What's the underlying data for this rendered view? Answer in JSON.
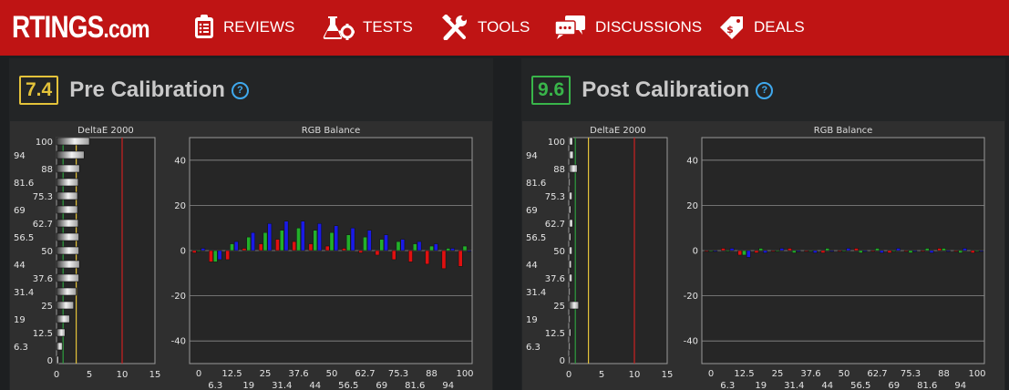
{
  "nav": {
    "logo": "RTINGS",
    "logo_suffix": ".com",
    "items": [
      {
        "label": "REVIEWS",
        "icon": "clipboard-icon"
      },
      {
        "label": "TESTS",
        "icon": "flask-icon"
      },
      {
        "label": "TOOLS",
        "icon": "tools-icon"
      },
      {
        "label": "DISCUSSIONS",
        "icon": "chat-icon"
      },
      {
        "label": "DEALS",
        "icon": "tag-icon"
      }
    ]
  },
  "panels": [
    {
      "score": "7.4",
      "title": "Pre Calibration",
      "score_color": "#e4c33a",
      "help": "?"
    },
    {
      "score": "9.6",
      "title": "Post Calibration",
      "score_color": "#39b54a",
      "help": "?"
    }
  ],
  "chart_data": [
    {
      "type": "bar",
      "title": "DeltaE 2000",
      "categories": [
        "100",
        "94",
        "88",
        "81.6",
        "75.3",
        "69",
        "62.7",
        "56.5",
        "50",
        "44",
        "37.6",
        "31.4",
        "25",
        "19",
        "12.5",
        "6.3",
        "0"
      ],
      "values": [
        5.0,
        4.2,
        3.5,
        3.3,
        3.2,
        3.2,
        3.3,
        3.4,
        3.4,
        3.5,
        3.4,
        3.0,
        2.6,
        2.0,
        1.3,
        0.9,
        0.3
      ],
      "xlim": [
        0,
        15
      ],
      "xticks": [
        "0",
        "5",
        "10",
        "15"
      ],
      "reference_lines": [
        {
          "x": 1,
          "color": "#2e9e3e"
        },
        {
          "x": 3,
          "color": "#e4c33a"
        },
        {
          "x": 10,
          "color": "#cc2020"
        }
      ]
    },
    {
      "type": "bar",
      "title": "RGB Balance",
      "categories": [
        "0",
        "6.3",
        "12.5",
        "19",
        "25",
        "31.4",
        "37.6",
        "44",
        "50",
        "56.5",
        "62.7",
        "69",
        "75.3",
        "81.6",
        "88",
        "94",
        "100"
      ],
      "xtick_rows": [
        [
          "0",
          "12.5",
          "25",
          "37.6",
          "50",
          "62.7",
          "75.3",
          "88",
          "100"
        ],
        [
          "6.3",
          "19",
          "31.4",
          "44",
          "56.5",
          "69",
          "81.6",
          "94"
        ]
      ],
      "ylim": [
        -50,
        50
      ],
      "yticks": [
        "40",
        "20",
        "0",
        "-20",
        "-40"
      ],
      "series": [
        {
          "name": "Red",
          "color": "#e01010",
          "values": [
            -1,
            -5,
            -4,
            1,
            3,
            5,
            4,
            3,
            2,
            1,
            -1,
            -2,
            -4,
            -5,
            -6,
            -8,
            -7
          ]
        },
        {
          "name": "Green",
          "color": "#22b02a",
          "values": [
            0,
            -5,
            3,
            6,
            8,
            9,
            10,
            9,
            8,
            7,
            6,
            5,
            4,
            3,
            2,
            1,
            2
          ]
        },
        {
          "name": "Blue",
          "color": "#1a1ae6",
          "values": [
            1,
            -4,
            4,
            8,
            12,
            13,
            13,
            12,
            11,
            10,
            9,
            7,
            5,
            4,
            3,
            1,
            0
          ]
        }
      ]
    },
    {
      "type": "bar",
      "title": "DeltaE 2000",
      "categories": [
        "100",
        "94",
        "88",
        "81.6",
        "75.3",
        "69",
        "62.7",
        "56.5",
        "50",
        "44",
        "37.6",
        "31.4",
        "25",
        "19",
        "12.5",
        "6.3",
        "0"
      ],
      "values": [
        0.6,
        0.7,
        1.3,
        0.2,
        0.5,
        0.3,
        0.6,
        0.3,
        0.5,
        0.4,
        0.5,
        0.2,
        1.5,
        0.2,
        0.3,
        0.2,
        0.1
      ],
      "xlim": [
        0,
        15
      ],
      "xticks": [
        "0",
        "5",
        "10",
        "15"
      ],
      "reference_lines": [
        {
          "x": 1,
          "color": "#2e9e3e"
        },
        {
          "x": 3,
          "color": "#e4c33a"
        },
        {
          "x": 10,
          "color": "#cc2020"
        }
      ]
    },
    {
      "type": "bar",
      "title": "RGB Balance",
      "categories": [
        "0",
        "6.3",
        "12.5",
        "19",
        "25",
        "31.4",
        "37.6",
        "44",
        "50",
        "56.5",
        "62.7",
        "69",
        "75.3",
        "81.6",
        "88",
        "94",
        "100"
      ],
      "xtick_rows": [
        [
          "0",
          "12.5",
          "25",
          "37.6",
          "50",
          "62.7",
          "75.3",
          "88",
          "100"
        ],
        [
          "6.3",
          "19",
          "31.4",
          "44",
          "56.5",
          "69",
          "81.6",
          "94"
        ]
      ],
      "ylim": [
        -50,
        50
      ],
      "yticks": [
        "40",
        "20",
        "0",
        "-20",
        "-40"
      ],
      "series": [
        {
          "name": "Red",
          "color": "#e01010",
          "values": [
            0,
            1,
            -2,
            -1,
            0,
            1,
            0,
            -1,
            0,
            1,
            0,
            -1,
            0,
            0,
            1,
            0,
            -1
          ]
        },
        {
          "name": "Green",
          "color": "#22b02a",
          "values": [
            0,
            0,
            -2,
            1,
            0,
            -1,
            0,
            1,
            0,
            -1,
            1,
            0,
            -1,
            1,
            1,
            -1,
            0
          ]
        },
        {
          "name": "Blue",
          "color": "#1a1ae6",
          "values": [
            0,
            1,
            -3,
            -1,
            1,
            0,
            -1,
            0,
            1,
            0,
            -1,
            1,
            0,
            -1,
            0,
            1,
            0
          ]
        }
      ]
    }
  ]
}
